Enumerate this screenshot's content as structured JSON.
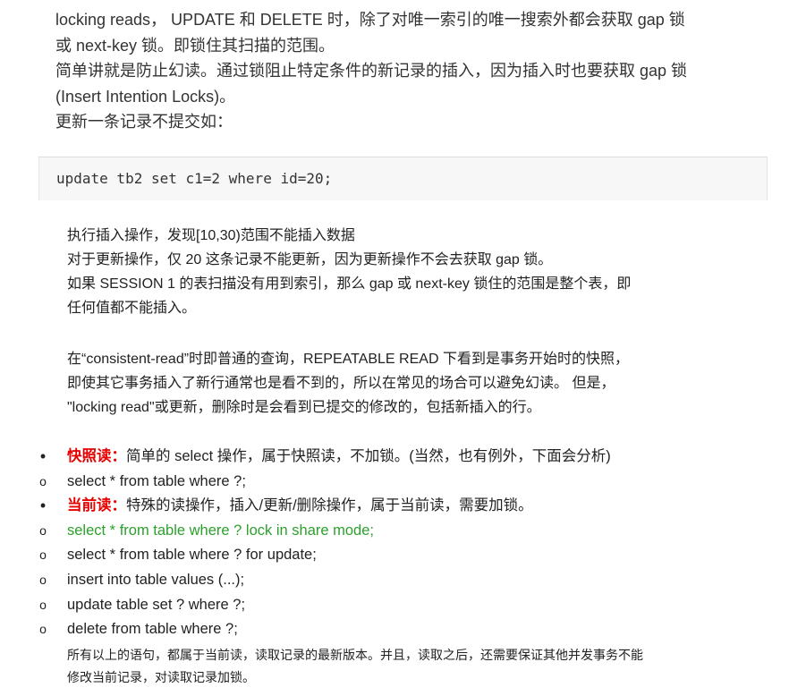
{
  "intro": {
    "line1": "locking reads， UPDATE 和 DELETE 时，除了对唯一索引的唯一搜索外都会获取 gap 锁",
    "line2": "或 next-key 锁。即锁住其扫描的范围。",
    "line3": "简单讲就是防止幻读。通过锁阻止特定条件的新记录的插入，因为插入时也要获取 gap 锁",
    "line4": "(Insert Intention Locks)。",
    "line5": "更新一条记录不提交如："
  },
  "code": {
    "statement": "update tb2 set c1=2 where id=20;"
  },
  "explanation": {
    "line1": "执行插入操作，发现[10,30)范围不能插入数据",
    "line2": "对于更新操作，仅 20 这条记录不能更新，因为更新操作不会去获取 gap 锁。",
    "line3": "如果 SESSION 1 的表扫描没有用到索引，那么 gap 或 next-key 锁住的范围是整个表，即",
    "line4": "任何值都不能插入。"
  },
  "consistent_read": {
    "line1": "在“consistent-read”时即普通的查询，REPEATABLE READ 下看到是事务开始时的快照，",
    "line2": "即使其它事务插入了新行通常也是看不到的，所以在常见的场合可以避免幻读。 但是，",
    "line3": "\"locking read\"或更新，删除时是会看到已提交的修改的，包括新插入的行。"
  },
  "list": {
    "items": [
      {
        "marker": "•",
        "label": "快照读：",
        "text": "简单的 select 操作，属于快照读，不加锁。(当然，也有例外，下面会分析)"
      },
      {
        "marker": "o",
        "text": "select * from table where ?;"
      },
      {
        "marker": "•",
        "label": "当前读：",
        "text": "特殊的读操作，插入/更新/删除操作，属于当前读，需要加锁。"
      },
      {
        "marker": "o",
        "text": "select * from table where ? lock in share mode;"
      },
      {
        "marker": "o",
        "text": "select * from table where ? for update;"
      },
      {
        "marker": "o",
        "text": "insert into table values (...);"
      },
      {
        "marker": "o",
        "text": "update table set ? where ?;"
      },
      {
        "marker": "o",
        "text": "delete from table where ?;"
      }
    ]
  },
  "footnote": {
    "line1": "所有以上的语句，都属于当前读，读取记录的最新版本。并且，读取之后，还需要保证其他并发事务不能",
    "line2": "修改当前记录，对读取记录加锁。"
  },
  "colors": {
    "label_red": "#e60000",
    "highlight_green": "#2ca02c",
    "code_bg": "#f7f7f7",
    "text": "#333333"
  }
}
